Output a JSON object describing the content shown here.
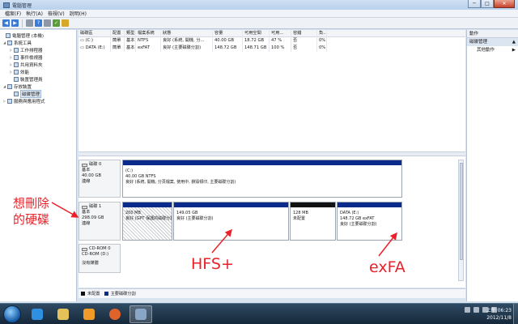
{
  "window": {
    "title": "電腦管理",
    "minimize": "─",
    "maximize": "□",
    "close": "✕"
  },
  "menu": [
    "檔案(F)",
    "執行(A)",
    "檢視(V)",
    "說明(H)"
  ],
  "tree": [
    {
      "label": "電腦管理 (本機)",
      "level": 0,
      "expand": ""
    },
    {
      "label": "系統工具",
      "level": 1,
      "expand": "◢"
    },
    {
      "label": "工作排程器",
      "level": 2,
      "expand": "▷"
    },
    {
      "label": "事件檢視器",
      "level": 2,
      "expand": "▷"
    },
    {
      "label": "共用資料夾",
      "level": 2,
      "expand": "▷"
    },
    {
      "label": "效能",
      "level": 2,
      "expand": "▷"
    },
    {
      "label": "裝置管理員",
      "level": 2,
      "expand": ""
    },
    {
      "label": "存放裝置",
      "level": 1,
      "expand": "◢"
    },
    {
      "label": "磁碟管理",
      "level": 2,
      "expand": "",
      "selected": true
    },
    {
      "label": "服務與應用程式",
      "level": 1,
      "expand": "▷"
    }
  ],
  "volumes": {
    "headers": [
      "磁碟區",
      "配置",
      "類型",
      "檔案系統",
      "狀態",
      "容量",
      "可用空間",
      "可用...",
      "容錯",
      "負..."
    ],
    "rows": [
      [
        "(C:)",
        "簡單",
        "基本",
        "NTFS",
        "良好 (系統, 開機, 分...",
        "40.00 GB",
        "18.72 GB",
        "47 %",
        "否",
        "0%"
      ],
      [
        "DATA (E:)",
        "簡單",
        "基本",
        "exFAT",
        "良好 (主要磁碟分割)",
        "148.72 GB",
        "148.71 GB",
        "100 %",
        "否",
        "0%"
      ]
    ]
  },
  "disks": [
    {
      "name": "磁碟 0",
      "type": "基本",
      "size": "40.00 GB",
      "status": "連線",
      "partitions": [
        {
          "lines": [
            "(C:)",
            "40.00 GB NTFS",
            "良好 (系統, 開機, 分頁檔案, 使用中, 損毀傾印, 主要磁碟分割)"
          ],
          "color": "#0a2b8c"
        }
      ]
    },
    {
      "name": "磁碟 1",
      "type": "基本",
      "size": "298.09 GB",
      "status": "連線",
      "partitions": [
        {
          "lines": [
            "200 MB",
            "良好 (GPT 保護的磁碟分割)"
          ],
          "color": "#0a2b8c",
          "hatch": true
        },
        {
          "lines": [
            "149.05 GB",
            "良好 (主要磁碟分割)"
          ],
          "color": "#0a2b8c"
        },
        {
          "lines": [
            "128 MB",
            "未配置"
          ],
          "color": "#111111"
        },
        {
          "lines": [
            "DATA (E:)",
            "148.72 GB exFAT",
            "良好 (主要磁碟分割)"
          ],
          "color": "#0a2b8c"
        }
      ]
    },
    {
      "name": "CD-ROM 0",
      "type": "CD-ROM (D:)",
      "size": "",
      "status": "",
      "media": "沒有媒體"
    }
  ],
  "legend": [
    {
      "label": "未配置",
      "color": "#111111"
    },
    {
      "label": "主要磁碟分割",
      "color": "#0a2b8c"
    }
  ],
  "actions": {
    "header": "動作",
    "section": "磁碟管理",
    "more": "其他動作",
    "section_arrow": "▲",
    "more_arrow": "▶"
  },
  "annotations": {
    "delete_label": [
      "想刪除",
      "的硬碟"
    ],
    "hfs": "HFS+",
    "exfat": "exFA"
  },
  "clock": {
    "time": "上午 06:23",
    "date": "2012/11/8"
  },
  "colors": {
    "primary_partition": "#0a2b8c",
    "unallocated": "#111111",
    "annotation": "#e8212a"
  }
}
